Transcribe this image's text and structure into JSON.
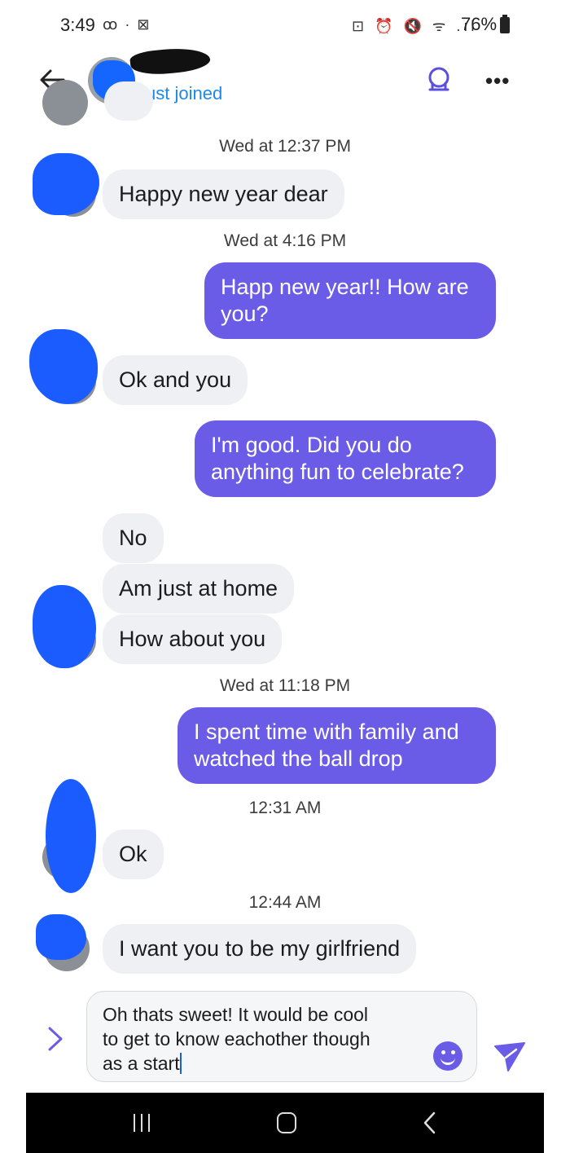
{
  "status_bar": {
    "time": "3:49",
    "left_icons": "ꝏ · ⊠",
    "right_icons": "⊡ ⏰ 🔇 ᯤ .ıl",
    "battery": "76%"
  },
  "header": {
    "status": "Just joined"
  },
  "messages": [
    {
      "kind": "timestamp",
      "text": "Wed at 12:37 PM"
    },
    {
      "kind": "incoming",
      "text": "Happy new year dear"
    },
    {
      "kind": "timestamp",
      "text": "Wed at 4:16 PM"
    },
    {
      "kind": "outgoing",
      "lines": [
        "Happ new year!! How are",
        "you?"
      ]
    },
    {
      "kind": "incoming",
      "text": "Ok and you"
    },
    {
      "kind": "outgoing",
      "lines": [
        "I'm good. Did you do",
        "anything fun to celebrate?"
      ]
    },
    {
      "kind": "incoming",
      "text": "No"
    },
    {
      "kind": "incoming",
      "text": "Am just at home"
    },
    {
      "kind": "incoming",
      "text": "How about you"
    },
    {
      "kind": "timestamp",
      "text": "Wed at 11:18 PM"
    },
    {
      "kind": "outgoing",
      "lines": [
        "I spent time with family and",
        "watched the ball drop"
      ]
    },
    {
      "kind": "timestamp",
      "text": "12:31 AM"
    },
    {
      "kind": "incoming",
      "text": "Ok"
    },
    {
      "kind": "timestamp",
      "text": "12:44 AM"
    },
    {
      "kind": "incoming",
      "text": "I want you to be my girlfriend"
    }
  ],
  "composer": {
    "lines": [
      "Oh thats sweet! It would be cool",
      "to get to know eachother though",
      "as a start"
    ]
  },
  "colors": {
    "accent": "#6b5ce7",
    "incoming_bubble": "#eef0f4",
    "link_blue": "#1e88e5"
  }
}
